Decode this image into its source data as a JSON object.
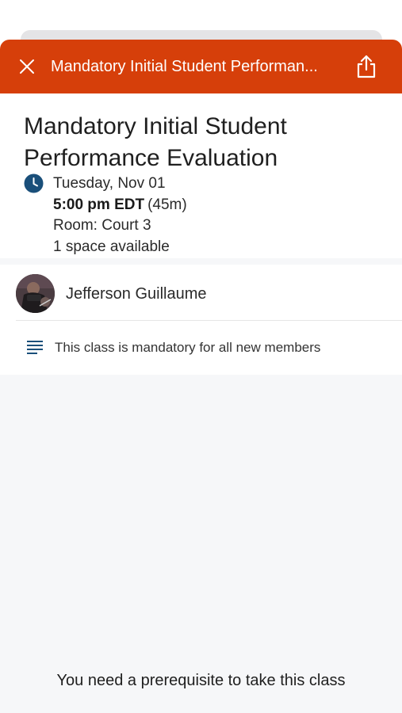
{
  "colors": {
    "header_bg": "#d63f0a",
    "accent_blue": "#1a4f7a",
    "lower_bg": "#f6f7f9"
  },
  "header": {
    "title": "Mandatory Initial Student Performan...",
    "close_icon": "close-icon",
    "share_icon": "share-icon"
  },
  "class": {
    "title": "Mandatory Initial Student Performance Evaluation",
    "date": "Tuesday, Nov 01",
    "time": "5:00 pm EDT",
    "duration": "(45m)",
    "room": "Room: Court 3",
    "availability": "1 space available",
    "clock_icon": "clock-icon"
  },
  "instructor": {
    "name": "Jefferson Guillaume",
    "avatar": "avatar-photo"
  },
  "description": {
    "icon": "text-lines-icon",
    "text": "This class is mandatory for all new members"
  },
  "footer": {
    "prerequisite_message": "You need a prerequisite to take this class"
  }
}
